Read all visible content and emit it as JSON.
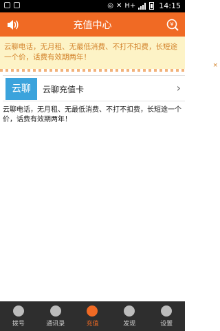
{
  "status_bar": {
    "time": "14:15",
    "network": "H+"
  },
  "header": {
    "title": "充值中心",
    "left_icon": "speaker-icon",
    "right_icon": "search-coin-icon",
    "color": "#f06a24"
  },
  "notice": {
    "text": "云聊电话，无月租、无最低消费、不打不扣费，长短途一个价，话费有效期两年！",
    "close_label": "×",
    "bg_color": "#fdf3c6"
  },
  "card": {
    "logo_text": "云聊",
    "label": "云聊充值卡",
    "chevron": "›"
  },
  "description": "云聊电话，无月租、无最低消费、不打不扣费，长短途一个价，话费有效期两年！",
  "tabs": [
    {
      "label": "拨号",
      "icon": "dialpad-icon",
      "active": false
    },
    {
      "label": "通讯录",
      "icon": "contacts-icon",
      "active": false
    },
    {
      "label": "充值",
      "icon": "recharge-icon",
      "active": true
    },
    {
      "label": "发现",
      "icon": "discover-icon",
      "active": false
    },
    {
      "label": "设置",
      "icon": "settings-icon",
      "active": false
    }
  ]
}
